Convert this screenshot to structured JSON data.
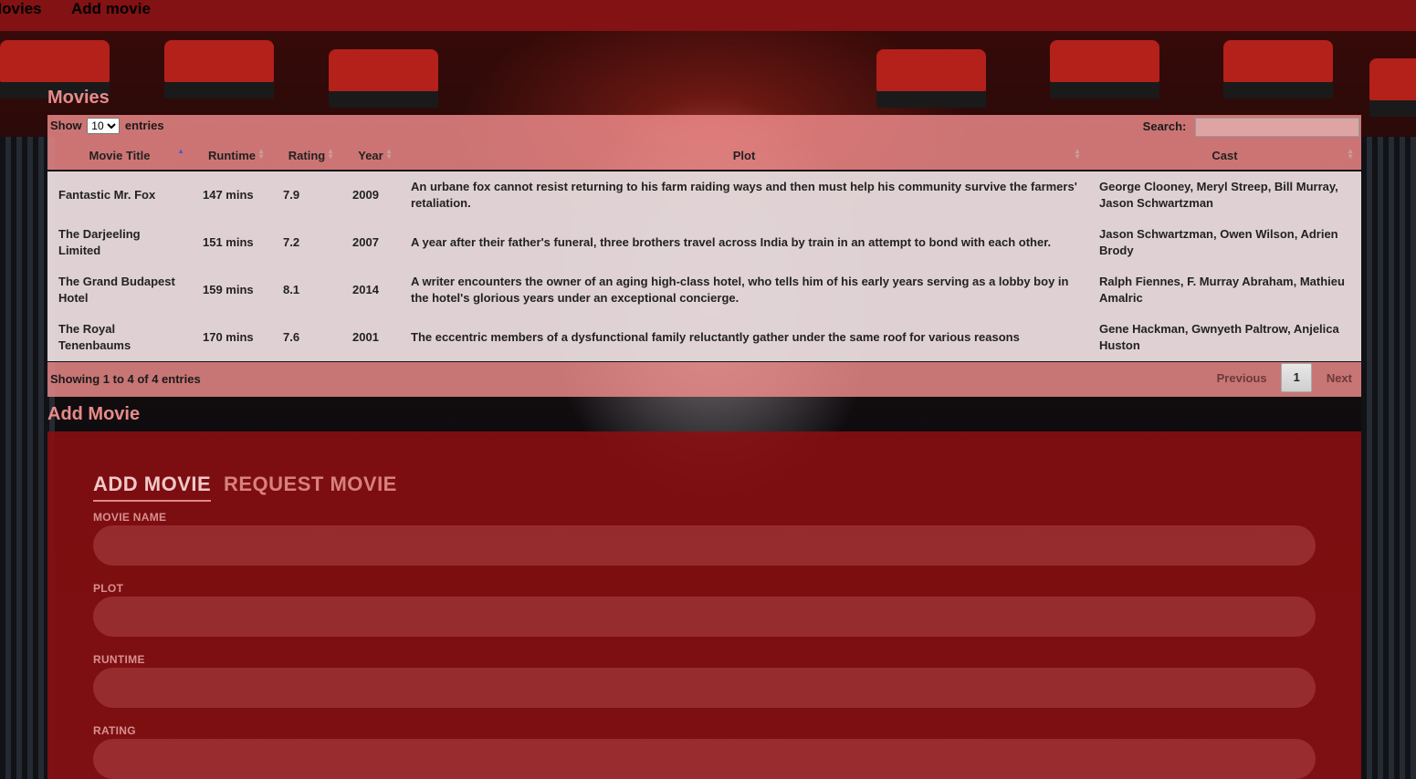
{
  "nav": {
    "movies": "Movies",
    "add_movie": "Add movie"
  },
  "movies_section": {
    "title": "Movies",
    "show_label": "Show",
    "length_value": "10",
    "entries_label": "entries",
    "search_label": "Search:",
    "search_value": "",
    "columns": [
      "Movie Title",
      "Runtime",
      "Rating",
      "Year",
      "Plot",
      "Cast"
    ],
    "rows": [
      {
        "title": "Fantastic Mr. Fox",
        "runtime": "147 mins",
        "rating": "7.9",
        "year": "2009",
        "plot": "An urbane fox cannot resist returning to his farm raiding ways and then must help his community survive the farmers' retaliation.",
        "cast": "George Clooney, Meryl Streep, Bill Murray, Jason Schwartzman"
      },
      {
        "title": "The Darjeeling Limited",
        "runtime": "151 mins",
        "rating": "7.2",
        "year": "2007",
        "plot": "A year after their father's funeral, three brothers travel across India by train in an attempt to bond with each other.",
        "cast": "Jason Schwartzman, Owen Wilson, Adrien Brody"
      },
      {
        "title": "The Grand Budapest Hotel",
        "runtime": "159 mins",
        "rating": "8.1",
        "year": "2014",
        "plot": "A writer encounters the owner of an aging high-class hotel, who tells him of his early years serving as a lobby boy in the hotel's glorious years under an exceptional concierge.",
        "cast": "Ralph Fiennes, F. Murray Abraham, Mathieu Amalric"
      },
      {
        "title": "The Royal Tenenbaums",
        "runtime": "170 mins",
        "rating": "7.6",
        "year": "2001",
        "plot": "The eccentric members of a dysfunctional family reluctantly gather under the same roof for various reasons",
        "cast": "Gene Hackman, Gwnyeth Paltrow, Anjelica Huston"
      }
    ],
    "info": "Showing 1 to 4 of 4 entries",
    "pager": {
      "previous": "Previous",
      "current": "1",
      "next": "Next"
    }
  },
  "add_section": {
    "title": "Add Movie",
    "tabs": {
      "add": "ADD MOVIE",
      "request": "REQUEST MOVIE"
    },
    "fields": {
      "movie_name": {
        "label": "MOVIE NAME",
        "value": ""
      },
      "plot": {
        "label": "PLOT",
        "value": ""
      },
      "runtime": {
        "label": "RUNTIME",
        "value": ""
      },
      "rating": {
        "label": "RATING",
        "value": ""
      }
    }
  },
  "colors": {
    "nav_bg": "#821213",
    "title_color": "#ea8a8a",
    "panel_pink": "#f08c8c",
    "form_bg": "#8c0e10"
  }
}
